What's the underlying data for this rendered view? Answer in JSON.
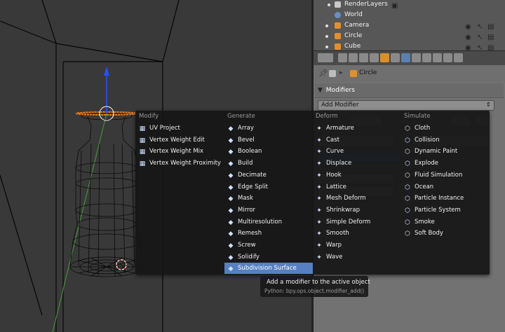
{
  "outliner": {
    "items": [
      {
        "label": "RenderLayers",
        "icon": "render-layers-icon"
      },
      {
        "label": "World",
        "icon": "world-icon"
      },
      {
        "label": "Camera",
        "icon": "camera-icon"
      },
      {
        "label": "Circle",
        "icon": "mesh-icon"
      },
      {
        "label": "Cube",
        "icon": "mesh-icon"
      }
    ]
  },
  "properties": {
    "object_name": "Circle",
    "panel_title": "Modifiers",
    "add_modifier_label": "Add Modifier"
  },
  "menu": {
    "columns": [
      {
        "heading": "Modify",
        "items": [
          "UV Project",
          "Vertex Weight Edit",
          "Vertex Weight Mix",
          "Vertex Weight Proximity"
        ]
      },
      {
        "heading": "Generate",
        "items": [
          "Array",
          "Bevel",
          "Boolean",
          "Build",
          "Decimate",
          "Edge Split",
          "Mask",
          "Mirror",
          "Multiresolution",
          "Remesh",
          "Screw",
          "Solidify",
          "Subdivision Surface"
        ]
      },
      {
        "heading": "Deform",
        "items": [
          "Armature",
          "Cast",
          "Curve",
          "Displace",
          "Hook",
          "Lattice",
          "Mesh Deform",
          "Shrinkwrap",
          "Simple Deform",
          "Smooth",
          "Warp",
          "Wave"
        ]
      },
      {
        "heading": "Simulate",
        "items": [
          "Cloth",
          "Collision",
          "Dynamic Paint",
          "Explode",
          "Fluid Simulation",
          "Ocean",
          "Particle Instance",
          "Particle System",
          "Smoke",
          "Soft Body"
        ]
      }
    ],
    "highlighted_item": "Subdivision Surface"
  },
  "tooltip": {
    "title": "Add a modifier to the active object",
    "python": "Python: bpy.ops.object.modifier_add()"
  },
  "colors": {
    "viewport_bg": "#393939",
    "menu_highlight": "#5680c2",
    "panel_bg": "#727272"
  }
}
